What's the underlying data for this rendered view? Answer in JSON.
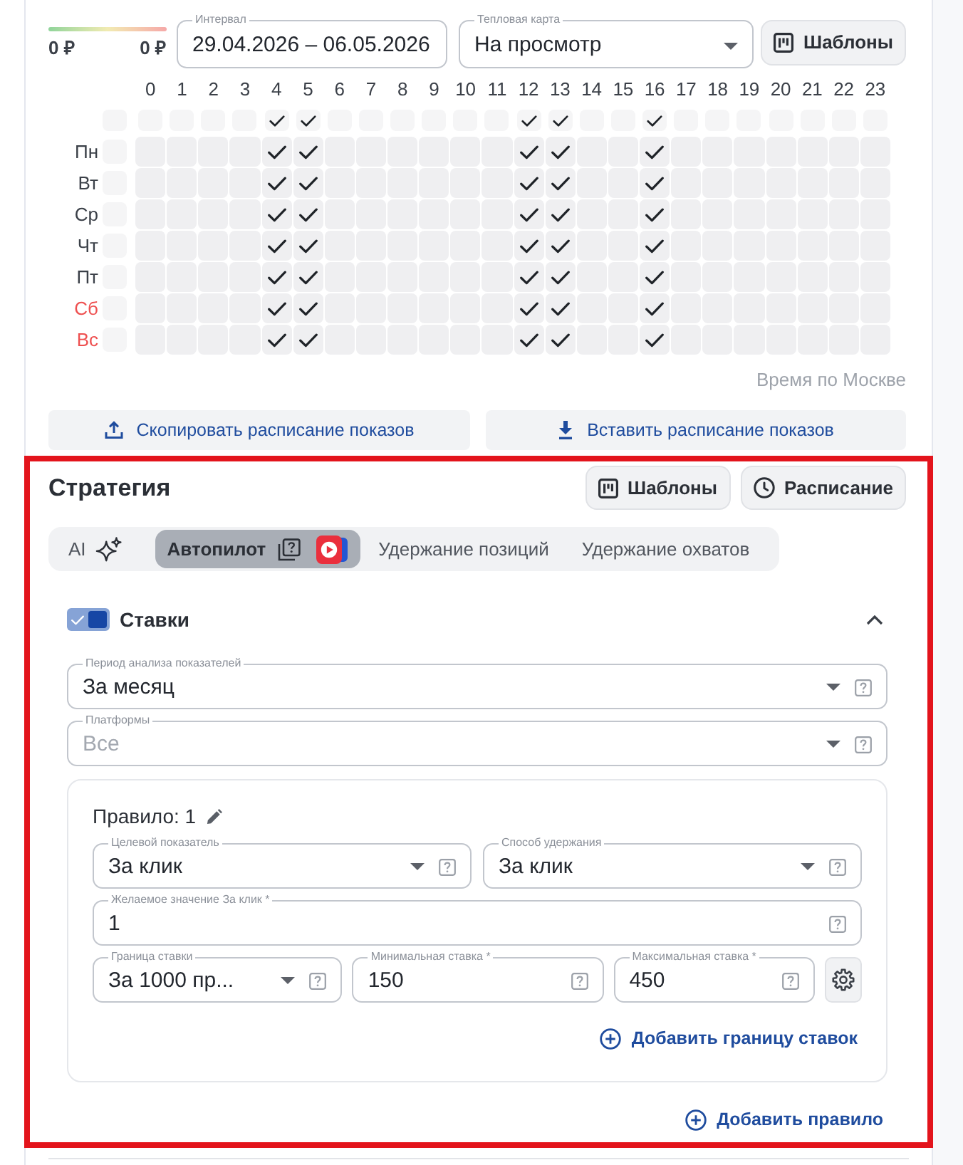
{
  "summary": {
    "min_amount": "0 ₽",
    "max_amount": "0 ₽"
  },
  "filters": [
    {
      "kind": "text",
      "label": "Интервал",
      "value": "29.04.2026 – 06.05.2026"
    },
    {
      "kind": "select",
      "label": "Тепловая карта",
      "value": "На просмотр"
    }
  ],
  "templates_button": {
    "label": "Шаблоны"
  },
  "schedule": {
    "hours": [
      "0",
      "1",
      "2",
      "3",
      "4",
      "5",
      "6",
      "7",
      "8",
      "9",
      "10",
      "11",
      "12",
      "13",
      "14",
      "15",
      "16",
      "17",
      "18",
      "19",
      "20",
      "21",
      "22",
      "23"
    ],
    "all_checked": false,
    "hour_checked": [
      false,
      false,
      false,
      false,
      true,
      true,
      false,
      false,
      false,
      false,
      false,
      false,
      true,
      true,
      false,
      false,
      true,
      false,
      false,
      false,
      false,
      false,
      false,
      false
    ],
    "days": [
      {
        "label": "Пн",
        "weekend": false,
        "row_checked": false,
        "checked": [
          false,
          false,
          false,
          false,
          true,
          true,
          false,
          false,
          false,
          false,
          false,
          false,
          true,
          true,
          false,
          false,
          true,
          false,
          false,
          false,
          false,
          false,
          false,
          false
        ]
      },
      {
        "label": "Вт",
        "weekend": false,
        "row_checked": false,
        "checked": [
          false,
          false,
          false,
          false,
          true,
          true,
          false,
          false,
          false,
          false,
          false,
          false,
          true,
          true,
          false,
          false,
          true,
          false,
          false,
          false,
          false,
          false,
          false,
          false
        ]
      },
      {
        "label": "Ср",
        "weekend": false,
        "row_checked": false,
        "checked": [
          false,
          false,
          false,
          false,
          true,
          true,
          false,
          false,
          false,
          false,
          false,
          false,
          true,
          true,
          false,
          false,
          true,
          false,
          false,
          false,
          false,
          false,
          false,
          false
        ]
      },
      {
        "label": "Чт",
        "weekend": false,
        "row_checked": false,
        "checked": [
          false,
          false,
          false,
          false,
          true,
          true,
          false,
          false,
          false,
          false,
          false,
          false,
          true,
          true,
          false,
          false,
          true,
          false,
          false,
          false,
          false,
          false,
          false,
          false
        ]
      },
      {
        "label": "Пт",
        "weekend": false,
        "row_checked": false,
        "checked": [
          false,
          false,
          false,
          false,
          true,
          true,
          false,
          false,
          false,
          false,
          false,
          false,
          true,
          true,
          false,
          false,
          true,
          false,
          false,
          false,
          false,
          false,
          false,
          false
        ]
      },
      {
        "label": "Сб",
        "weekend": true,
        "row_checked": false,
        "checked": [
          false,
          false,
          false,
          false,
          true,
          true,
          false,
          false,
          false,
          false,
          false,
          false,
          true,
          true,
          false,
          false,
          true,
          false,
          false,
          false,
          false,
          false,
          false,
          false
        ]
      },
      {
        "label": "Вс",
        "weekend": true,
        "row_checked": false,
        "checked": [
          false,
          false,
          false,
          false,
          true,
          true,
          false,
          false,
          false,
          false,
          false,
          false,
          true,
          true,
          false,
          false,
          true,
          false,
          false,
          false,
          false,
          false,
          false,
          false
        ]
      }
    ],
    "note": "Время по Москве",
    "actions": [
      {
        "kind": "copy",
        "label": "Скопировать расписание показов"
      },
      {
        "kind": "paste",
        "label": "Вставить расписание показов"
      }
    ]
  },
  "strategy": {
    "title": "Стратегия",
    "buttons": [
      {
        "kind": "templates",
        "label": "Шаблоны"
      },
      {
        "kind": "schedule",
        "label": "Расписание"
      }
    ],
    "tabs": [
      {
        "kind": "ai",
        "label": "AI",
        "selected": false
      },
      {
        "kind": "autopilot",
        "label": "Автопилот",
        "selected": true
      },
      {
        "kind": "plain",
        "label": "Удержание позиций",
        "selected": false
      },
      {
        "kind": "plain",
        "label": "Удержание охватов",
        "selected": false
      }
    ],
    "bids": {
      "title": "Ставки",
      "on": true,
      "expanded": true,
      "fields": [
        {
          "kind": "select",
          "label": "Период анализа показателей",
          "value": "За месяц"
        },
        {
          "kind": "select",
          "label": "Платформы",
          "placeholder": "Все"
        }
      ],
      "rules": [
        {
          "title": "Правило: 1",
          "rows": [
            {
              "items": [
                {
                  "kind": "select",
                  "label": "Целевой показатель",
                  "value": "За клик"
                },
                {
                  "kind": "select",
                  "label": "Способ удержания",
                  "value": "За клик"
                }
              ]
            },
            {
              "items": [
                {
                  "kind": "input",
                  "label": "Желаемое значение За клик *",
                  "value": "1"
                }
              ]
            },
            {
              "items": [
                {
                  "kind": "select",
                  "label": "Граница ставки",
                  "value": "За 1000 пр..."
                },
                {
                  "kind": "input",
                  "label": "Минимальная ставка *",
                  "value": "150"
                },
                {
                  "kind": "input",
                  "label": "Максимальная ставка *",
                  "value": "450"
                },
                {
                  "kind": "settings"
                }
              ]
            }
          ],
          "add_limit_link": "Добавить границу ставок"
        }
      ],
      "add_rule_link": "Добавить правило"
    }
  }
}
